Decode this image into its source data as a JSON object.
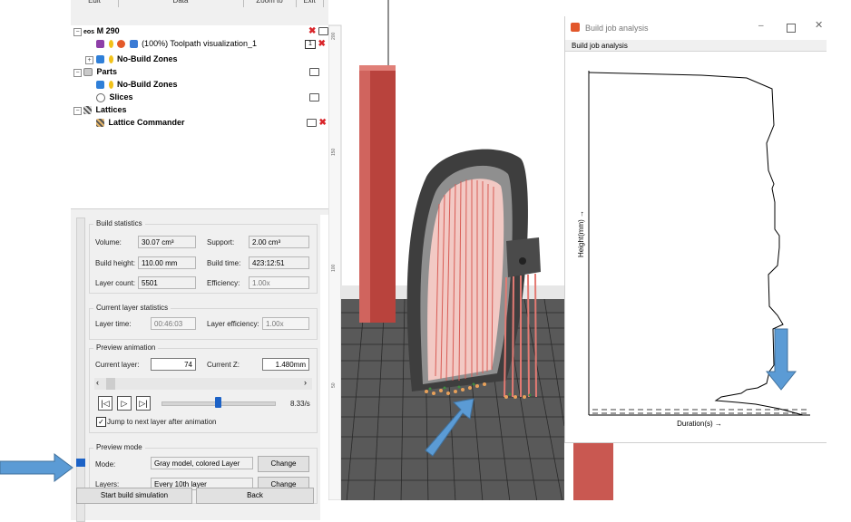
{
  "menu": {
    "tabs": [
      "Edit",
      "Data",
      "Zoom to",
      "Exit"
    ]
  },
  "tree": {
    "machine": "M 290",
    "toolpath": "(100%) Toolpath visualization_1",
    "toolpath_badge": "1",
    "nbz1": "No-Build Zones",
    "parts": "Parts",
    "nbz2": "No-Build Zones",
    "slices": "Slices",
    "lattices": "Lattices",
    "lattice_commander": "Lattice Commander"
  },
  "build_statistics": {
    "title": "Build statistics",
    "volume_label": "Volume:",
    "volume": "30.07 cm³",
    "support_label": "Support:",
    "support": "2.00 cm³",
    "height_label": "Build height:",
    "height": "110.00 mm",
    "time_label": "Build time:",
    "time": "423:12:51",
    "layers_label": "Layer count:",
    "layers": "5501",
    "efficiency_label": "Efficiency:",
    "efficiency": "1.00x"
  },
  "current_layer": {
    "title": "Current layer statistics",
    "time_label": "Layer time:",
    "time": "00:46:03",
    "eff_label": "Layer efficiency:",
    "eff": "1.00x"
  },
  "preview_animation": {
    "title": "Preview animation",
    "layer_label": "Current layer:",
    "layer": "74",
    "z_label": "Current Z:",
    "z": "1.480mm",
    "speed": "8.33/s",
    "speed_fraction": 0.5,
    "jump_label": "Jump to next layer after animation",
    "jump_checked": true
  },
  "preview_mode": {
    "title": "Preview mode",
    "mode_label": "Mode:",
    "mode": "Gray model, colored Layer",
    "layers_label": "Layers:",
    "layers": "Every 10th layer",
    "change": "Change"
  },
  "footer": {
    "start": "Start build simulation",
    "back": "Back"
  },
  "ruler_labels": [
    "200",
    "150",
    "100",
    "50"
  ],
  "bja": {
    "title": "Build job analysis",
    "header": "Build job analysis",
    "ylabel": "Height(mm) →",
    "xlabel": "Duration(s) →"
  },
  "colors": {
    "accent": "#1c62c6",
    "arrow": "#5b9bd5",
    "support": "#e37a73",
    "part": "#4b4b4b"
  },
  "icons": [
    "machine-icon",
    "toolpath-icon",
    "lock-icon",
    "bulb-icon",
    "parts-icon",
    "slices-icon",
    "lattice-icon",
    "folder-icon",
    "close-icon",
    "minimize-icon",
    "maximize-icon",
    "app-icon"
  ]
}
